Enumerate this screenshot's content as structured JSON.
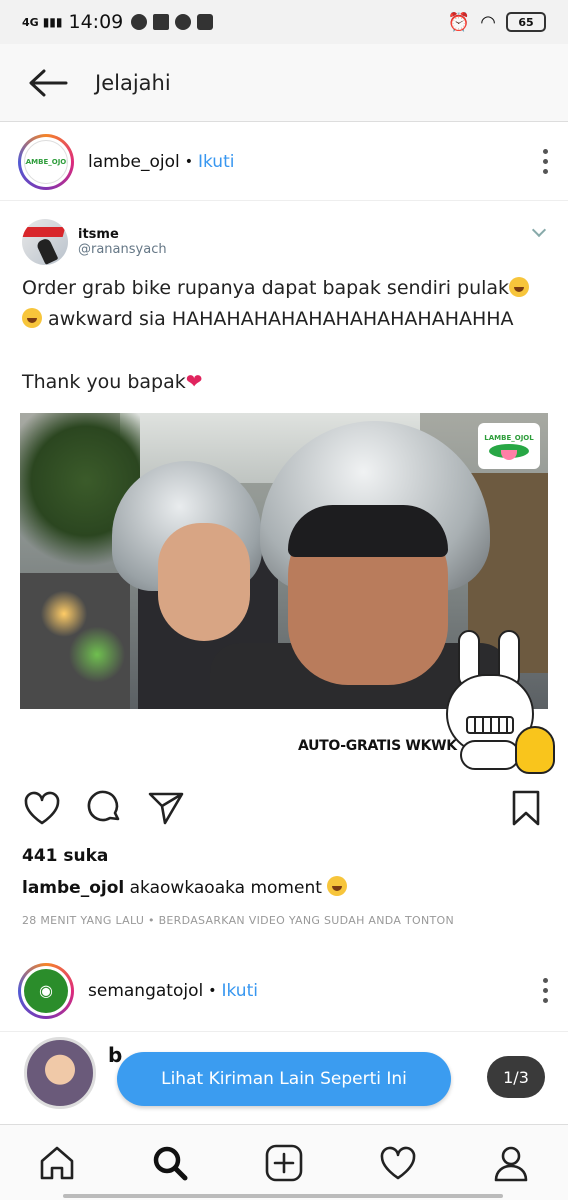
{
  "status_bar": {
    "network": "4G",
    "time": "14:09",
    "battery": "65"
  },
  "app_bar": {
    "title": "Jelajahi",
    "back_icon": "arrow-left-icon"
  },
  "post": {
    "username": "lambe_ojol",
    "follow_label": "Ikuti",
    "avatar_text": "LAMBE_OJOL",
    "tweet": {
      "name": "itsme",
      "handle": "@ranansyach",
      "text_line1": "Order grab bike rupanya dapat bapak sendiri pulak",
      "text_line2": "awkward sia HAHAHAHAHAHAHAHAHAHAHAHHA",
      "text_line3": "Thank you bapak",
      "photo_watermark": "LAMBE_OJOL",
      "photo_caption": "AUTO-GRATIS WKWK"
    },
    "likes": "441 suka",
    "caption_user": "lambe_ojol",
    "caption_text": "akaowkaoaka moment",
    "meta": "28 MENIT YANG LALU • BERDASARKAN VIDEO YANG SUDAH ANDA TONTON"
  },
  "post2": {
    "username": "semangatojol",
    "follow_label": "Ikuti"
  },
  "suggestion": {
    "name_partial": "b",
    "button_label": "Lihat Kiriman Lain Seperti Ini",
    "pager": "1/3"
  },
  "bottom_nav": [
    "home-icon",
    "search-icon",
    "add-post-icon",
    "activity-heart-icon",
    "profile-icon"
  ],
  "colors": {
    "accent": "#3897f0",
    "pill": "#3b9cf0",
    "heart": "#e0245e"
  }
}
